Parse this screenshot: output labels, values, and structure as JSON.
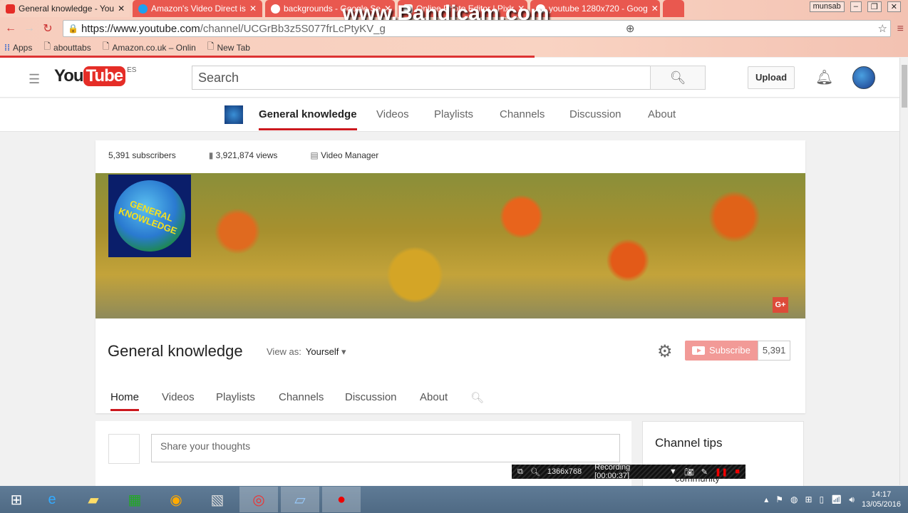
{
  "browser": {
    "tabs": [
      {
        "title": "General knowledge - You",
        "active": true,
        "favicon": "#e52d27"
      },
      {
        "title": "Amazon's Video Direct is",
        "favicon": "#1ea0f0"
      },
      {
        "title": "backgrounds - Google Se",
        "favicon": "#4285f4"
      },
      {
        "title": "Online Photo Editor | Pixlr",
        "favicon": "#ffffff"
      },
      {
        "title": "youtube 1280x720 - Goog",
        "favicon": "#4285f4"
      }
    ],
    "url_host": "https://www.youtube.com",
    "url_path": "/channel/UCGrBb3z5S077frLcPtyKV_g",
    "bookmarks": [
      "Apps",
      "abouttabs",
      "Amazon.co.uk – Onlin",
      "New Tab"
    ],
    "user": "munsab",
    "watermark": "www.Bandicam.com"
  },
  "youtube": {
    "logo_you": "You",
    "logo_tube": "Tube",
    "region": "ES",
    "search_placeholder": "Search",
    "upload": "Upload"
  },
  "channel_nav": [
    "General knowledge",
    "Videos",
    "Playlists",
    "Channels",
    "Discussion",
    "About"
  ],
  "stats": {
    "subscribers": "5,391 subscribers",
    "views": "3,921,874 views",
    "manager": "Video Manager"
  },
  "channel": {
    "name": "General knowledge",
    "avatar_text": "GENERAL KNOWLEDGE",
    "view_as_label": "View as:",
    "view_as_value": "Yourself",
    "subscribe": "Subscribe",
    "sub_count": "5,391",
    "gplus": "G+"
  },
  "tabs": [
    "Home",
    "Videos",
    "Playlists",
    "Channels",
    "Discussion",
    "About"
  ],
  "post": {
    "placeholder": "Share your thoughts"
  },
  "tips": {
    "title": "Channel tips",
    "item": "community"
  },
  "recorder": {
    "resolution": "1366x768",
    "status": "Recording [00:00:37]"
  },
  "taskbar": {
    "time": "14:17",
    "date": "13/05/2016"
  }
}
